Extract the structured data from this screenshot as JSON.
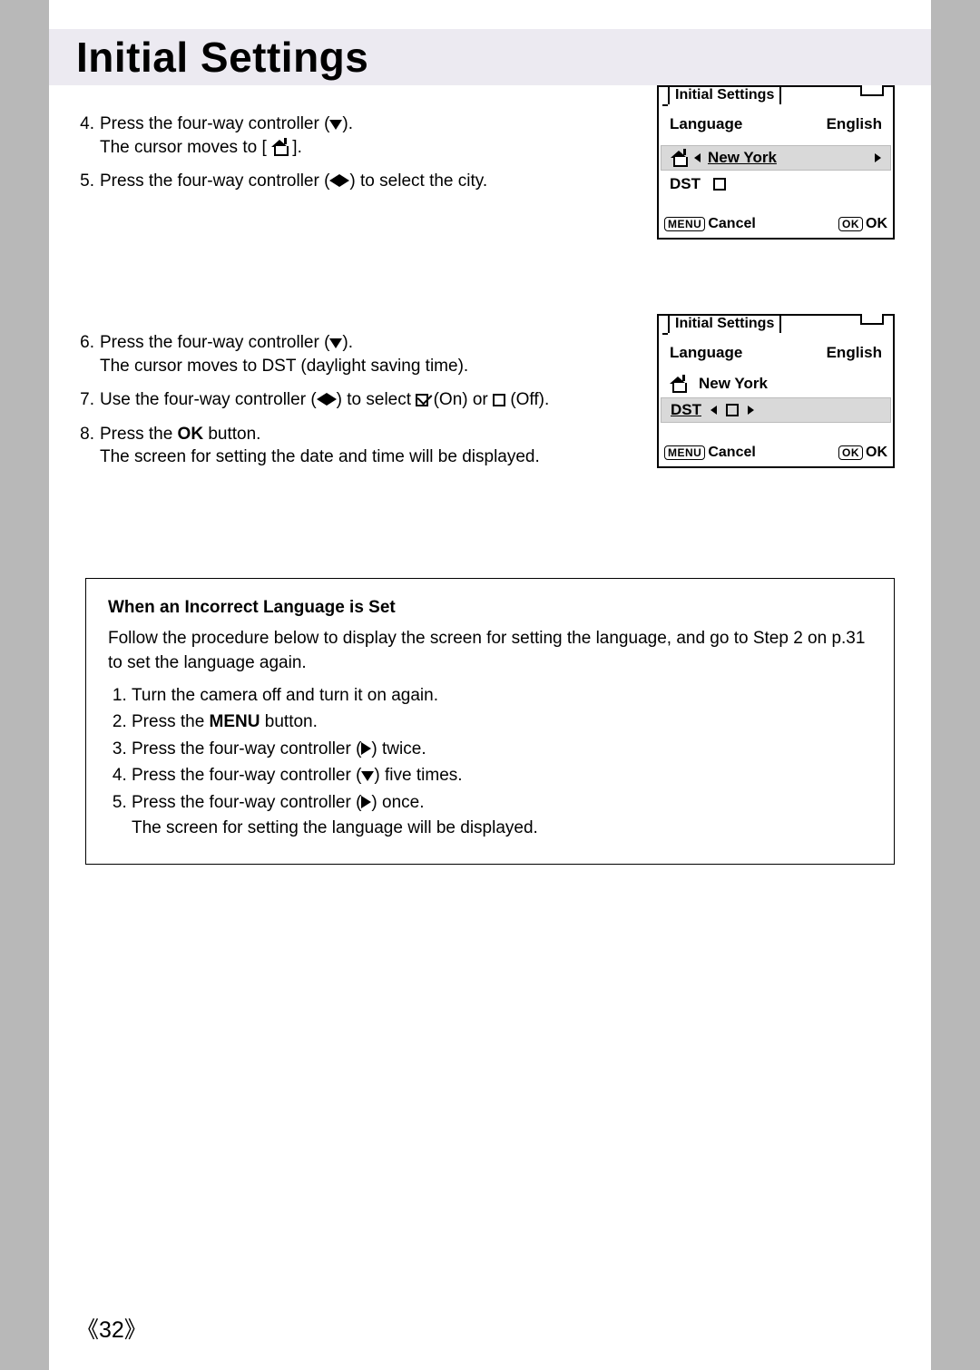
{
  "title": "Initial Settings",
  "steps_a": [
    {
      "num": "4.",
      "lines": [
        "Press the four-way controller ({DOWN}).",
        "The cursor moves to [ {HOME} ]."
      ]
    },
    {
      "num": "5.",
      "lines": [
        "Press the four-way controller ({LR}) to select the city."
      ]
    }
  ],
  "steps_b": [
    {
      "num": "6.",
      "lines": [
        "Press the four-way controller ({DOWN}).",
        "The cursor moves to DST (daylight saving time)."
      ]
    },
    {
      "num": "7.",
      "lines": [
        "Use the four-way controller ({LR}) to select {CBC} (On) or {CB} (Off)."
      ]
    },
    {
      "num": "8.",
      "lines": [
        "Press the {OKB} button.",
        "The screen for setting the date and time will be displayed."
      ]
    }
  ],
  "lcd": {
    "title": "Initial Settings",
    "language_label": "Language",
    "language_value": "English",
    "city": "New York",
    "dst_label": "DST",
    "menu_label": "MENU",
    "cancel": "Cancel",
    "ok_box": "OK",
    "ok_label": "OK"
  },
  "callout": {
    "title": "When an Incorrect Language is Set",
    "intro": "Follow the procedure below to display the screen for setting the language, and go to Step 2 on p.31 to set the language again.",
    "items": [
      "Turn the camera off and turn it on again.",
      "Press the {MENUB} button.",
      "Press the four-way controller ({RIGHT}) twice.",
      "Press the four-way controller ({DOWN}) five times.",
      "Press the four-way controller ({RIGHT}) once.\nThe screen for setting the language will be displayed."
    ]
  },
  "page_number": "《32》",
  "ok_bold": "OK",
  "menu_bold": "MENU"
}
